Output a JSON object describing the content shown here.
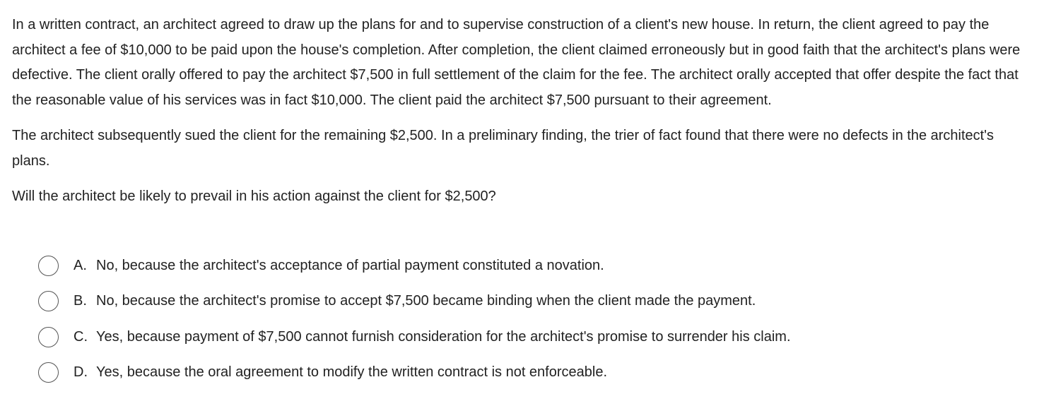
{
  "question": {
    "paragraphs": [
      "In a written contract, an architect agreed to draw up the plans for and to supervise construction of a client's new house.  In return, the client agreed to pay the architect a fee of $10,000 to be paid upon the house's completion.  After completion, the client claimed erroneously but in good faith that the architect's plans were defective.  The client orally offered to pay the architect $7,500 in full settlement of the claim for the fee.  The architect orally accepted that offer despite the fact that the reasonable value of his services was in fact $10,000.  The client paid the architect $7,500 pursuant to their agreement.",
      "The architect subsequently sued the client for the remaining $2,500.  In a preliminary finding, the trier of fact found that there were no defects in the architect's plans.",
      "Will the architect be likely to prevail in his action against the client for $2,500?"
    ]
  },
  "options": [
    {
      "letter": "A.",
      "text": "No, because the architect's acceptance of partial payment constituted a novation."
    },
    {
      "letter": "B.",
      "text": "No, because the architect's promise to accept $7,500 became binding when the client made the payment."
    },
    {
      "letter": "C.",
      "text": "Yes, because payment of $7,500 cannot furnish consideration for the architect's promise to surrender his claim."
    },
    {
      "letter": "D.",
      "text": "Yes, because the oral agreement to modify the written contract is not enforceable."
    }
  ]
}
